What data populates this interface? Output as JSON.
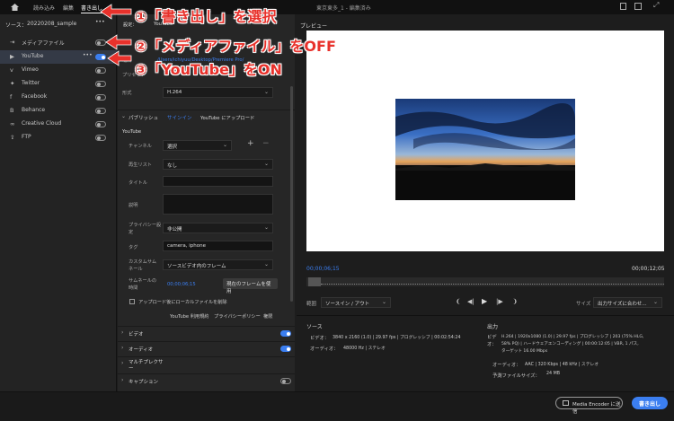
{
  "topbar": {
    "home_icon": "home-icon",
    "tabs": [
      "読み込み",
      "編集",
      "書き出し"
    ],
    "doc_title": "東京東多_1 - 編集済み",
    "topright_icons": [
      "export-icon",
      "window-icon",
      "close-icon"
    ]
  },
  "left": {
    "source_label": "ソース：",
    "source_name": "20220208_sample",
    "more": "•••",
    "items": [
      {
        "icon": "media-file-icon",
        "label": "メディアファイル",
        "on": false
      },
      {
        "icon": "youtube-icon",
        "label": "YouTube",
        "on": true
      },
      {
        "icon": "vimeo-icon",
        "label": "Vimeo",
        "on": false
      },
      {
        "icon": "twitter-icon",
        "label": "Twitter",
        "on": false
      },
      {
        "icon": "facebook-icon",
        "label": "Facebook",
        "on": false
      },
      {
        "icon": "behance-icon",
        "label": "Behance",
        "on": false
      },
      {
        "icon": "creative-cloud-icon",
        "label": "Creative Cloud",
        "on": false
      },
      {
        "icon": "ftp-icon",
        "label": "FTP",
        "on": false
      }
    ]
  },
  "settings": {
    "header": "設定：",
    "platform": "YouTube",
    "location_label": "場所",
    "location_path": "/Users/ichiyuu/Desktop/Premiere Pro/",
    "preset_label": "プリセット",
    "format_label": "形式",
    "format_value": "H.264",
    "publish": {
      "title": "パブリッシュ",
      "signin": "サインイン",
      "signin_desc": "YouTube にアップロード",
      "sub": "YouTube",
      "channel_label": "チャンネル",
      "channel_value": "選択",
      "playlist_label": "再生リスト",
      "playlist_value": "なし",
      "title_label": "タイトル",
      "desc_label": "説明",
      "privacy_label": "プライバシー設定",
      "privacy_value": "非公開",
      "tags_label": "タグ",
      "tags_value": "camera, iphone",
      "thumb_label": "カスタムサムネール",
      "thumb_value": "ソースビデオ内のフレーム",
      "thumb_time_label": "サムネールの時間",
      "thumb_time_value": "00;00;06;15",
      "current_frame_btn": "現在のフレームを使用",
      "delete_local": "アップロード後にローカルファイルを削除",
      "links": [
        "YouTube 利用規約",
        "プライバシーポリシー",
        "権限"
      ]
    },
    "sections": [
      {
        "label": "ビデオ",
        "on": true
      },
      {
        "label": "オーディオ",
        "on": true
      },
      {
        "label": "マルチプレクサー",
        "on": null
      },
      {
        "label": "キャプション",
        "on": false
      }
    ]
  },
  "preview": {
    "label": "プレビュー",
    "timecode_start": "00;00;06;15",
    "timecode_end": "00;00;12;05",
    "range_label": "範囲",
    "range_value": "ソースイン / アウト",
    "size_label": "サイズ",
    "size_value": "出力サイズに合わせ..."
  },
  "source_info": {
    "title": "ソース",
    "video_label": "ビデオ：",
    "video_value": "3840 x 2160 (1.0) | 29.97 fps | プログレッシブ | 00:02:54:24",
    "audio_label": "オーディオ：",
    "audio_value": "48000 Hz | ステレオ"
  },
  "output_info": {
    "title": "出力",
    "video_label": "ビデオ：",
    "video_line1": "H.264 | 1920x1080 (1.0) | 29.97 fps | プログレッシブ | 203 (75% HLG,",
    "video_line2": "58% PQ) | ハードウェアエンコーディング | 00:00:12:05 | VBR, 1 パス,",
    "video_line3": "ターゲット 16.00 Mbps",
    "audio_label": "オーディオ：",
    "audio_value": "AAC | 320 Kbps | 48 kHz | ステレオ",
    "size_label": "予測ファイルサイズ：",
    "size_value": "24 MB"
  },
  "bottom": {
    "encoder_btn": "Media Encoder に送信",
    "export_btn": "書き出し"
  },
  "annotations": [
    {
      "text": "①「書き出し」を選択"
    },
    {
      "text": "②「メディアファイル」をOFF"
    },
    {
      "text": "③「YouTube」をON"
    }
  ],
  "colors": {
    "accent": "#3b7ef0",
    "annotation": "#e8312b"
  }
}
